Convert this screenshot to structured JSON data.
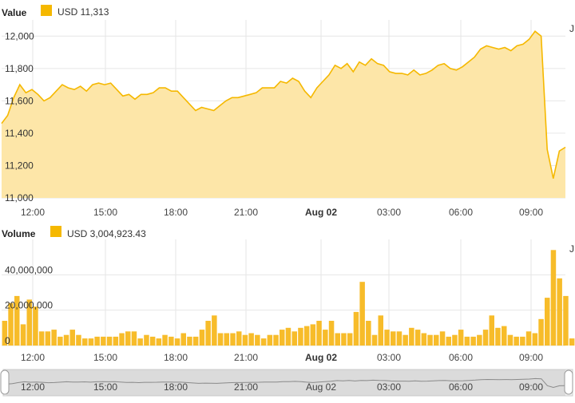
{
  "colors": {
    "accent": "#f5b800",
    "area": "#fde6a8",
    "bar": "#f7bc2a",
    "grid": "#e6e6e6",
    "navigator": "#cfcfcf"
  },
  "value_panel": {
    "title": "Value",
    "legend_label": "USD  11,313",
    "corner_label": "J"
  },
  "volume_panel": {
    "title": "Volume",
    "legend_label": "USD  3,004,923.43",
    "corner_label": "J"
  },
  "x_ticks": [
    {
      "label": "12:00",
      "bold": false
    },
    {
      "label": "15:00",
      "bold": false
    },
    {
      "label": "18:00",
      "bold": false
    },
    {
      "label": "21:00",
      "bold": false
    },
    {
      "label": "Aug 02",
      "bold": true
    },
    {
      "label": "03:00",
      "bold": false
    },
    {
      "label": "06:00",
      "bold": false
    },
    {
      "label": "09:00",
      "bold": false
    }
  ],
  "chart_data": [
    {
      "type": "area",
      "title": "Value",
      "series_name": "USD",
      "ylim": [
        11000,
        12100
      ],
      "yticks": [
        "11,000",
        "11,200",
        "11,400",
        "11,600",
        "11,800",
        "12,000"
      ],
      "ytick_values": [
        11000,
        11200,
        11400,
        11600,
        11800,
        12000
      ],
      "values": [
        11460,
        11510,
        11620,
        11700,
        11650,
        11670,
        11640,
        11600,
        11620,
        11660,
        11700,
        11680,
        11670,
        11690,
        11660,
        11700,
        11710,
        11700,
        11710,
        11670,
        11630,
        11640,
        11610,
        11640,
        11640,
        11650,
        11680,
        11680,
        11660,
        11660,
        11620,
        11580,
        11540,
        11560,
        11550,
        11540,
        11570,
        11600,
        11620,
        11620,
        11630,
        11640,
        11650,
        11680,
        11680,
        11680,
        11720,
        11710,
        11740,
        11720,
        11660,
        11620,
        11680,
        11720,
        11760,
        11820,
        11800,
        11830,
        11780,
        11840,
        11820,
        11860,
        11830,
        11820,
        11780,
        11770,
        11770,
        11760,
        11790,
        11760,
        11770,
        11790,
        11820,
        11830,
        11800,
        11790,
        11810,
        11840,
        11870,
        11920,
        11940,
        11930,
        11920,
        11930,
        11910,
        11940,
        11950,
        11980,
        12030,
        12000,
        11300,
        11120,
        11290,
        11313
      ]
    },
    {
      "type": "bar",
      "title": "Volume",
      "series_name": "USD",
      "ylim": [
        0,
        60000000
      ],
      "yticks": [
        "0",
        "20,000,000",
        "40,000,000"
      ],
      "ytick_values": [
        0,
        20000000,
        40000000
      ],
      "values": [
        14000000,
        24000000,
        28000000,
        12000000,
        26000000,
        22000000,
        8000000,
        8000000,
        9000000,
        5000000,
        6000000,
        9000000,
        6000000,
        4000000,
        4000000,
        5000000,
        5000000,
        5000000,
        5000000,
        7000000,
        8000000,
        8000000,
        4000000,
        6000000,
        5000000,
        4000000,
        6000000,
        5000000,
        4000000,
        7000000,
        5000000,
        5000000,
        9000000,
        14000000,
        17000000,
        7000000,
        7000000,
        7000000,
        8000000,
        6000000,
        7000000,
        6000000,
        4000000,
        6000000,
        6000000,
        9000000,
        10000000,
        8000000,
        10000000,
        11000000,
        12000000,
        14000000,
        9000000,
        14000000,
        7000000,
        7000000,
        7000000,
        19000000,
        36000000,
        14000000,
        6000000,
        17000000,
        9000000,
        8000000,
        8000000,
        6000000,
        10000000,
        9000000,
        7000000,
        6000000,
        6000000,
        8000000,
        5000000,
        6000000,
        9000000,
        5000000,
        5000000,
        6000000,
        9000000,
        17000000,
        10000000,
        11000000,
        6000000,
        5000000,
        5000000,
        8000000,
        7000000,
        15000000,
        27000000,
        54000000,
        38000000,
        28000000,
        4000000
      ]
    }
  ],
  "navigator": {
    "labels": [
      "12:00",
      "15:00",
      "18:00",
      "21:00",
      "Aug 02",
      "03:00",
      "06:00",
      "09:00"
    ]
  }
}
